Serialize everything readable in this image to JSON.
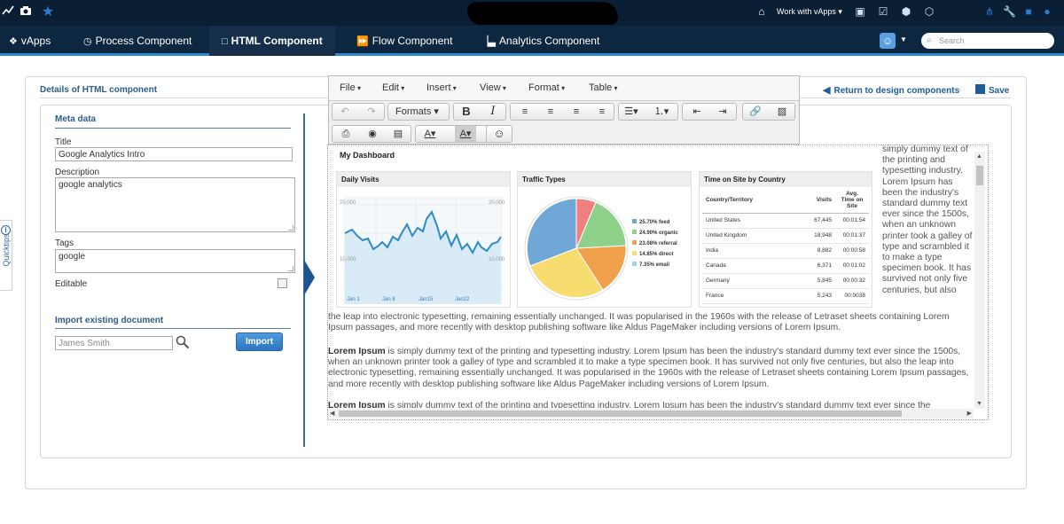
{
  "topbar": {
    "work_with_vapps": "Work with vApps ▾"
  },
  "nav": {
    "items": [
      {
        "label": "vApps",
        "glyph": "❖"
      },
      {
        "label": "Process Component",
        "glyph": "◷"
      },
      {
        "label": "HTML Component",
        "glyph": "□"
      },
      {
        "label": "Flow Component",
        "glyph": "⏩"
      },
      {
        "label": "Analytics Component",
        "glyph": "▕▃"
      }
    ],
    "active_index": 2,
    "search_placeholder": "Search"
  },
  "quicktips": {
    "label": "Quicktips"
  },
  "page": {
    "title": "Details of HTML component",
    "return_link": "Return to design components",
    "save_label": "Save"
  },
  "meta": {
    "section_title": "Meta data",
    "title_label": "Title",
    "title_value": "Google Analytics Intro",
    "description_label": "Description",
    "description_value": "google analytics",
    "tags_label": "Tags",
    "tags_value": "google",
    "editable_label": "Editable",
    "editable_checked": false
  },
  "import": {
    "section_title": "Import existing document",
    "input_value": "James Smith",
    "button_label": "Import"
  },
  "editor": {
    "menu": [
      "File",
      "Edit",
      "Insert",
      "View",
      "Format",
      "Table"
    ],
    "formats_label": "Formats ▾",
    "dashboard_title": "My Dashboard",
    "daily_visits": {
      "title": "Daily Visits",
      "y_top_left": "20,000",
      "y_top_right": "20,000",
      "y_mid_left": "10,000",
      "y_mid_right": "10,000",
      "x_labels": [
        "Jan 1",
        "Jan 8",
        "Jan15",
        "Jan22"
      ]
    },
    "traffic_types": {
      "title": "Traffic Types",
      "legend": [
        {
          "label": "25.70% feed",
          "color": "#6fa8d6"
        },
        {
          "label": "24.90% organic",
          "color": "#8fd08a"
        },
        {
          "label": "23.08% referral",
          "color": "#f0a04a"
        },
        {
          "label": "14.85% direct",
          "color": "#f7dc6f"
        },
        {
          "label": "7.35% email",
          "color": "#9fd2ee"
        }
      ]
    },
    "sites": {
      "title": "Time on Site by Country",
      "headers": [
        "Country/Territory",
        "Visits",
        "Avg. Time on Site"
      ],
      "rows": [
        [
          "United States",
          "67,445",
          "00:01:54"
        ],
        [
          "United Kingdom",
          "18,948",
          "00:01:37"
        ],
        [
          "India",
          "8,882",
          "00:00:58"
        ],
        [
          "Canada",
          "6,371",
          "00:01:02"
        ],
        [
          "Germany",
          "5,845",
          "00:00:32"
        ],
        [
          "France",
          "5,243",
          "00:0038"
        ]
      ]
    },
    "side_text": "simply dummy text of the printing and typesetting industry. Lorem Ipsum has been the industry's standard dummy text ever since the 1500s, when an unknown printer took a galley of type and scrambled it to make a type specimen book. It has survived not only five centuries, but also",
    "para1_rest": "the leap into electronic typesetting, remaining essentially unchanged. It was popularised in the 1960s with the release of Letraset sheets containing Lorem Ipsum passages, and more recently with desktop publishing software like Aldus PageMaker including versions of Lorem Ipsum.",
    "para2_bold": "Lorem Ipsum",
    "para2_text": " is simply dummy text of the printing and typesetting industry. Lorem Ipsum has been the industry's standard dummy text ever since the 1500s, when an unknown printer took a galley of type and scrambled it to make a type specimen book. It has survived not only five centuries, but also the leap into electronic typesetting, remaining essentially unchanged. It was popularised in the 1960s with the release of Letraset sheets containing Lorem Ipsum passages, and more recently with desktop publishing software like Aldus PageMaker including versions of Lorem Ipsum.",
    "para3_bold": "Lorem Ipsum",
    "para3_text": " is simply dummy text of the printing and typesetting industry. Lorem Ipsum has been the industry's standard dummy text ever since the"
  },
  "colors": {
    "topbar": "#0a1f33",
    "nav": "#0d2740",
    "accent": "#2e8bd0",
    "link": "#1f5c99"
  }
}
